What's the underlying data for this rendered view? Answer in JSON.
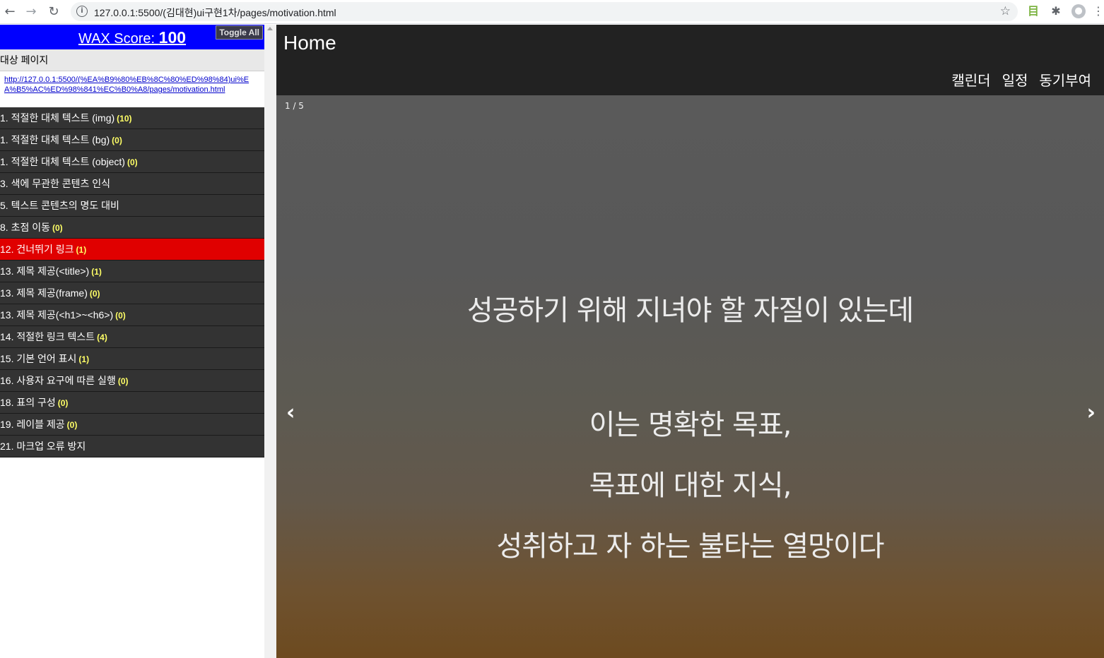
{
  "browser": {
    "url": "127.0.0.1:5500/(김대현)ui구현1차/pages/motivation.html"
  },
  "wax": {
    "score_label": "WAX Score: ",
    "score_value": "100",
    "toggle_all": "Toggle All",
    "target_label": "대상 페이지",
    "target_url": "http://127.0.0.1:5500/(%EA%B9%80%EB%8C%80%ED%98%84)ui%EA%B5%AC%ED%98%841%EC%B0%A8/pages/motivation.html",
    "items": [
      {
        "label": "1. 적절한 대체 텍스트 (img)",
        "count": "(10)"
      },
      {
        "label": "1. 적절한 대체 텍스트 (bg)",
        "count": "(0)"
      },
      {
        "label": "1. 적절한 대체 텍스트 (object)",
        "count": "(0)"
      },
      {
        "label": "3. 색에 무관한 콘텐츠 인식",
        "count": ""
      },
      {
        "label": "5. 텍스트 콘텐츠의 명도 대비",
        "count": ""
      },
      {
        "label": "8. 초점 이동",
        "count": "(0)"
      },
      {
        "label": "12. 건너뛰기 링크",
        "count": "(1)"
      },
      {
        "label": "13. 제목 제공(<title>)",
        "count": "(1)"
      },
      {
        "label": "13. 제목 제공(frame)",
        "count": "(0)"
      },
      {
        "label": "13. 제목 제공(<h1>~<h6>)",
        "count": "(0)"
      },
      {
        "label": "14. 적절한 링크 텍스트",
        "count": "(4)"
      },
      {
        "label": "15. 기본 언어 표시",
        "count": "(1)"
      },
      {
        "label": "16. 사용자 요구에 따른 실행",
        "count": "(0)"
      },
      {
        "label": "18. 표의 구성",
        "count": "(0)"
      },
      {
        "label": "19. 레이블 제공",
        "count": "(0)"
      },
      {
        "label": "21. 마크업 오류 방지",
        "count": ""
      }
    ]
  },
  "site": {
    "home": "Home",
    "menu": [
      "캘린더",
      "일정",
      "동기부여"
    ],
    "slide_counter": "1 / 5",
    "quote_lines": [
      "성공하기 위해 지녀야 할 자질이 있는데",
      "이는 명확한 목표,",
      "목표에 대한 지식,",
      "성취하고 자 하는 불타는 열망이다"
    ],
    "prev_arrow": "‹",
    "next_arrow": "›"
  },
  "colors": {
    "wax_header": "#0000ff",
    "wax_item_bg": "#333333",
    "wax_item_active": "#e00000",
    "wax_count": "#ffff66",
    "topbar": "#222222"
  }
}
